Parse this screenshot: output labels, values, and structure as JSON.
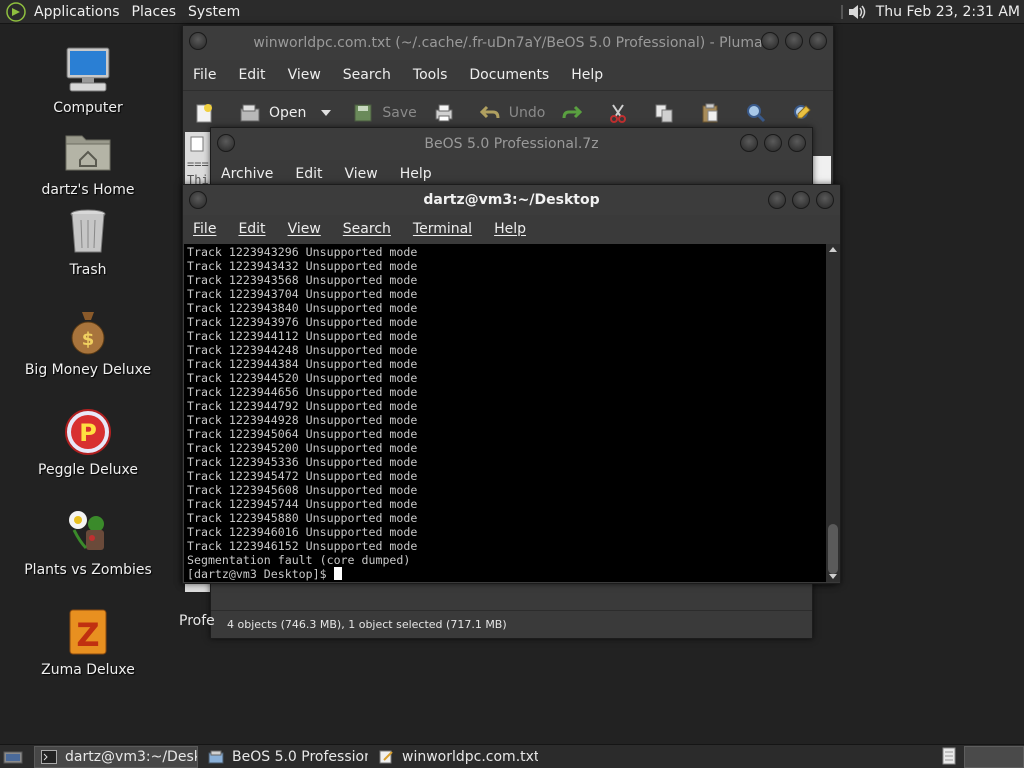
{
  "top_panel": {
    "menus": [
      "Applications",
      "Places",
      "System"
    ],
    "clock": "Thu Feb 23,  2:31 AM"
  },
  "desktop_icons": [
    {
      "label": "Computer",
      "icon": "computer-icon"
    },
    {
      "label": "dartz's Home",
      "icon": "home-folder-icon"
    },
    {
      "label": "Trash",
      "icon": "trash-icon"
    },
    {
      "label": "Big Money Deluxe",
      "icon": "money-bag-icon"
    },
    {
      "label": "Peggle Deluxe",
      "icon": "peggle-icon"
    },
    {
      "label": "Plants vs Zombies",
      "icon": "plants-icon"
    },
    {
      "label": "Zuma Deluxe",
      "icon": "zuma-icon"
    }
  ],
  "pluma": {
    "title": "winworldpc.com.txt (~/.cache/.fr-uDn7aY/BeOS 5.0 Professional) - Pluma",
    "menus": [
      "File",
      "Edit",
      "View",
      "Search",
      "Tools",
      "Documents",
      "Help"
    ],
    "toolbar": {
      "open": "Open",
      "save": "Save",
      "undo": "Undo"
    },
    "text_fragment_1": "===",
    "text_fragment_2": "Thi"
  },
  "archive": {
    "title": "BeOS 5.0 Professional.7z",
    "menus": [
      "Archive",
      "Edit",
      "View",
      "Help"
    ],
    "left_fragment": "Profe",
    "status": "4 objects (746.3 MB), 1 object selected (717.1 MB)"
  },
  "terminal": {
    "title": "dartz@vm3:~/Desktop",
    "menus": [
      "File",
      "Edit",
      "View",
      "Search",
      "Terminal",
      "Help"
    ],
    "lines": [
      "Track 1223943296 Unsupported mode",
      "Track 1223943432 Unsupported mode",
      "Track 1223943568 Unsupported mode",
      "Track 1223943704 Unsupported mode",
      "Track 1223943840 Unsupported mode",
      "Track 1223943976 Unsupported mode",
      "Track 1223944112 Unsupported mode",
      "Track 1223944248 Unsupported mode",
      "Track 1223944384 Unsupported mode",
      "Track 1223944520 Unsupported mode",
      "Track 1223944656 Unsupported mode",
      "Track 1223944792 Unsupported mode",
      "Track 1223944928 Unsupported mode",
      "Track 1223945064 Unsupported mode",
      "Track 1223945200 Unsupported mode",
      "Track 1223945336 Unsupported mode",
      "Track 1223945472 Unsupported mode",
      "Track 1223945608 Unsupported mode",
      "Track 1223945744 Unsupported mode",
      "Track 1223945880 Unsupported mode",
      "Track 1223946016 Unsupported mode",
      "Track 1223946152 Unsupported mode",
      "Segmentation fault (core dumped)"
    ],
    "prompt": "[dartz@vm3 Desktop]$ "
  },
  "taskbar": [
    {
      "label": "dartz@vm3:~/Deskt...",
      "active": true,
      "icon": "terminal-icon"
    },
    {
      "label": "BeOS 5.0 Profession...",
      "active": false,
      "icon": "archive-icon"
    },
    {
      "label": "winworldpc.com.txt ...",
      "active": false,
      "icon": "text-editor-icon"
    }
  ]
}
